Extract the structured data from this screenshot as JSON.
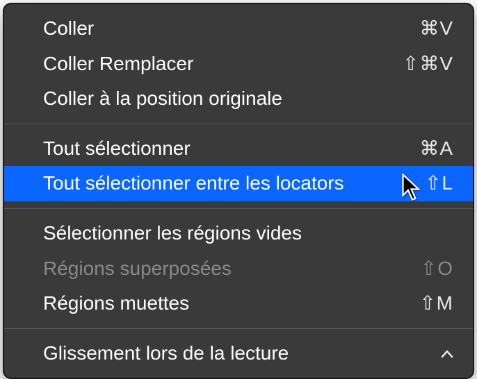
{
  "menu": {
    "groups": [
      [
        {
          "label": "Coller",
          "shortcut": "⌘V",
          "disabled": false,
          "highlighted": false,
          "submenu": false
        },
        {
          "label": "Coller Remplacer",
          "shortcut": "⇧⌘V",
          "disabled": false,
          "highlighted": false,
          "submenu": false
        },
        {
          "label": "Coller à la position originale",
          "shortcut": "",
          "disabled": false,
          "highlighted": false,
          "submenu": false
        }
      ],
      [
        {
          "label": "Tout sélectionner",
          "shortcut": "⌘A",
          "disabled": false,
          "highlighted": false,
          "submenu": false
        },
        {
          "label": "Tout sélectionner entre les locators",
          "shortcut": "⇧L",
          "disabled": false,
          "highlighted": true,
          "submenu": false
        }
      ],
      [
        {
          "label": "Sélectionner les régions vides",
          "shortcut": "",
          "disabled": false,
          "highlighted": false,
          "submenu": false
        },
        {
          "label": "Régions superposées",
          "shortcut": "⇧O",
          "disabled": true,
          "highlighted": false,
          "submenu": false
        },
        {
          "label": "Régions muettes",
          "shortcut": "⇧M",
          "disabled": false,
          "highlighted": false,
          "submenu": false
        }
      ],
      [
        {
          "label": "Glissement lors de la lecture",
          "shortcut": "",
          "disabled": false,
          "highlighted": false,
          "submenu": true
        }
      ]
    ]
  }
}
